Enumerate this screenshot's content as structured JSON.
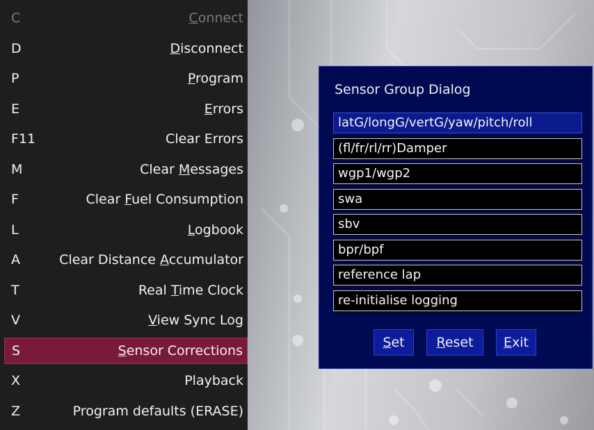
{
  "menu": {
    "items": [
      {
        "key": "C",
        "pre": "",
        "ul": "C",
        "post": "onnect",
        "disabled": true
      },
      {
        "key": "D",
        "pre": "",
        "ul": "D",
        "post": "isconnect"
      },
      {
        "key": "P",
        "pre": "",
        "ul": "P",
        "post": "rogram"
      },
      {
        "key": "E",
        "pre": "",
        "ul": "E",
        "post": "rrors"
      },
      {
        "key": "F11",
        "pre": "Clear Errors",
        "ul": "",
        "post": ""
      },
      {
        "key": "M",
        "pre": "Clear ",
        "ul": "M",
        "post": "essages"
      },
      {
        "key": "F",
        "pre": "Clear ",
        "ul": "F",
        "post": "uel Consumption"
      },
      {
        "key": "L",
        "pre": "",
        "ul": "L",
        "post": "ogbook"
      },
      {
        "key": "A",
        "pre": "Clear Distance ",
        "ul": "A",
        "post": "ccumulator"
      },
      {
        "key": "T",
        "pre": "Real ",
        "ul": "T",
        "post": "ime Clock"
      },
      {
        "key": "V",
        "pre": "",
        "ul": "V",
        "post": "iew Sync Log"
      },
      {
        "key": "S",
        "pre": "",
        "ul": "S",
        "post": "ensor Corrections",
        "selected": true
      },
      {
        "key": "X",
        "pre": "Playback",
        "ul": "",
        "post": ""
      },
      {
        "key": "Z",
        "pre": "Program defaults (ERASE)",
        "ul": "",
        "post": ""
      }
    ]
  },
  "dialog": {
    "title": "Sensor Group Dialog",
    "list": [
      "latG/longG/vertG/yaw/pitch/roll",
      "(fl/fr/rl/rr)Damper",
      "wgp1/wgp2",
      "swa",
      "sbv",
      "bpr/bpf",
      "reference lap",
      "re-initialise logging"
    ],
    "selected_index": 0,
    "buttons": [
      {
        "ul": "S",
        "post": "et"
      },
      {
        "ul": "R",
        "post": "eset"
      },
      {
        "ul": "E",
        "post": "xit"
      }
    ]
  },
  "colors": {
    "menu_bg": "#1e1e1e",
    "menu_selected": "#7a1a3a",
    "dialog_bg": "#000a52",
    "button_bg": "#0d1c9a"
  }
}
